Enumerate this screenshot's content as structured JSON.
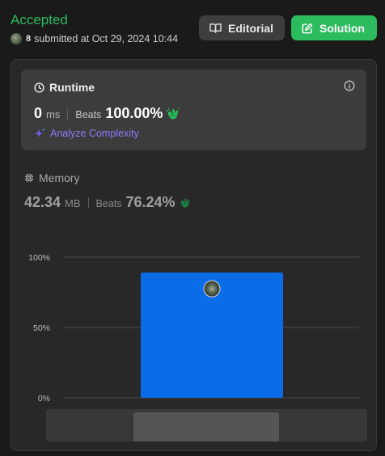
{
  "header": {
    "status": "Accepted",
    "username": "8",
    "submitted_text": "submitted at Oct 29, 2024 10:44",
    "editorial_label": "Editorial",
    "solution_label": "Solution"
  },
  "runtime": {
    "title": "Runtime",
    "value": "0",
    "unit": "ms",
    "beats_label": "Beats",
    "beats_value": "100.00%",
    "analyze_label": "Analyze Complexity"
  },
  "memory": {
    "title": "Memory",
    "value": "42.34",
    "unit": "MB",
    "beats_label": "Beats",
    "beats_value": "76.24%"
  },
  "colors": {
    "accepted": "#2cbb5d",
    "bar": "#0a6ce6",
    "analyze": "#8c7bf6"
  },
  "icons": [
    "book-open-icon",
    "edit-icon",
    "clock-icon",
    "info-icon",
    "sparkle-icon",
    "chip-icon",
    "clapping-hands-icon",
    "user-avatar"
  ],
  "chart_data": {
    "type": "bar",
    "categories": [
      ""
    ],
    "values": [
      89
    ],
    "ytick_labels": [
      "100%",
      "50%",
      "0%"
    ],
    "ylim": [
      0,
      100
    ],
    "grid": true,
    "xlabel": "",
    "ylabel": ""
  }
}
